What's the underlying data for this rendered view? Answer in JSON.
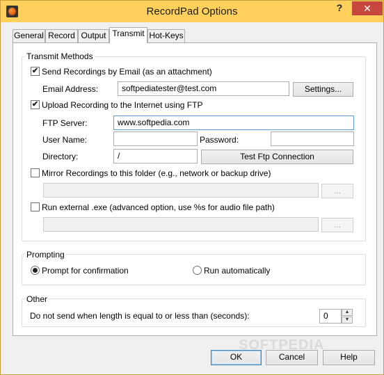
{
  "window": {
    "title": "RecordPad Options",
    "help_glyph": "?",
    "close_glyph": "✕",
    "accent_color": "#ffd15c",
    "close_color": "#c7463e"
  },
  "tabs": [
    {
      "label": "General",
      "active": false
    },
    {
      "label": "Record",
      "active": false
    },
    {
      "label": "Output",
      "active": false
    },
    {
      "label": "Transmit",
      "active": true
    },
    {
      "label": "Hot-Keys",
      "active": false
    }
  ],
  "transmit_methods": {
    "group_label": "Transmit Methods",
    "email": {
      "checkbox_label": "Send Recordings by Email (as an attachment)",
      "checked": true,
      "address_label": "Email Address:",
      "address_value": "softpediatester@test.com",
      "settings_button": "Settings..."
    },
    "ftp": {
      "checkbox_label": "Upload Recording to the Internet using FTP",
      "checked": true,
      "server_label": "FTP Server:",
      "server_value": "www.softpedia.com",
      "username_label": "User Name:",
      "username_value": "",
      "password_label": "Password:",
      "password_value": "",
      "directory_label": "Directory:",
      "directory_value": "/",
      "test_button": "Test Ftp Connection"
    },
    "mirror": {
      "checkbox_label": "Mirror Recordings to this folder (e.g., network or backup drive)",
      "checked": false,
      "path_value": "",
      "browse_button": "..."
    },
    "external": {
      "checkbox_label": "Run external .exe (advanced option, use %s for audio file path)",
      "checked": false,
      "path_value": "",
      "browse_button": "..."
    }
  },
  "prompting": {
    "group_label": "Prompting",
    "options": [
      {
        "label": "Prompt for confirmation",
        "selected": true
      },
      {
        "label": "Run automatically",
        "selected": false
      }
    ]
  },
  "other": {
    "group_label": "Other",
    "length_label": "Do not send when length is equal to or less than (seconds):",
    "length_value": "0"
  },
  "footer": {
    "ok_label": "OK",
    "cancel_label": "Cancel",
    "help_label": "Help"
  },
  "watermark": "SOFTPEDIA"
}
